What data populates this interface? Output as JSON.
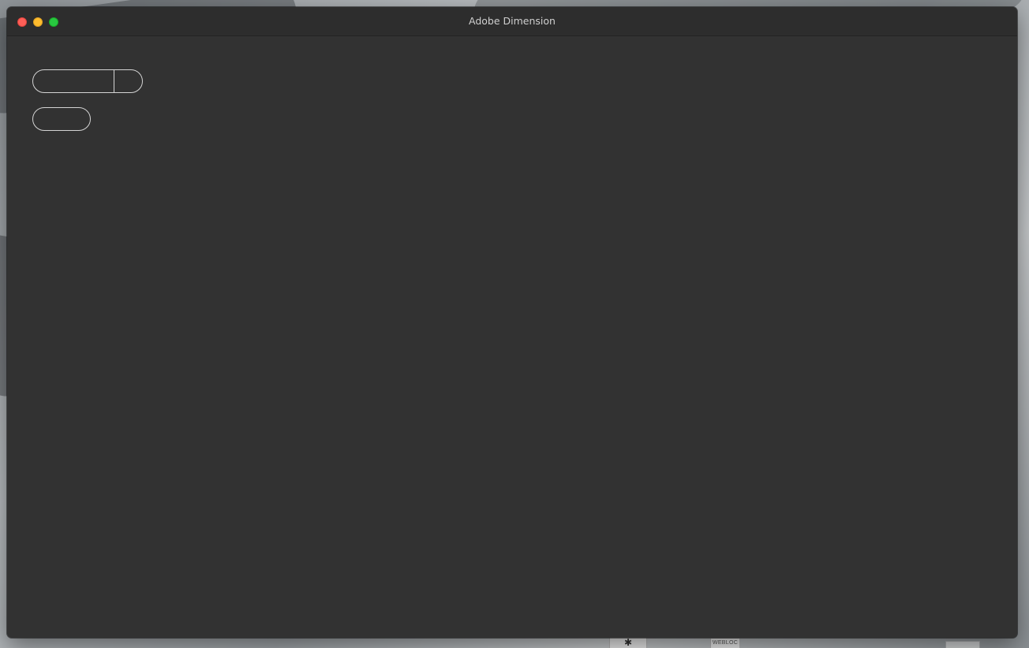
{
  "window": {
    "title": "Adobe Dimension"
  },
  "dock": {
    "webloc_label": "WEBLOC",
    "bug_icon": "bug-icon"
  },
  "colors": {
    "window_bg": "#323232",
    "titlebar_bg": "#2d2d2d",
    "close": "#fe5f57",
    "minimize": "#febc2e",
    "zoom": "#28c840",
    "button_outline": "#d4d4d4"
  },
  "controls": {
    "split_button_label": "",
    "single_button_label": ""
  }
}
